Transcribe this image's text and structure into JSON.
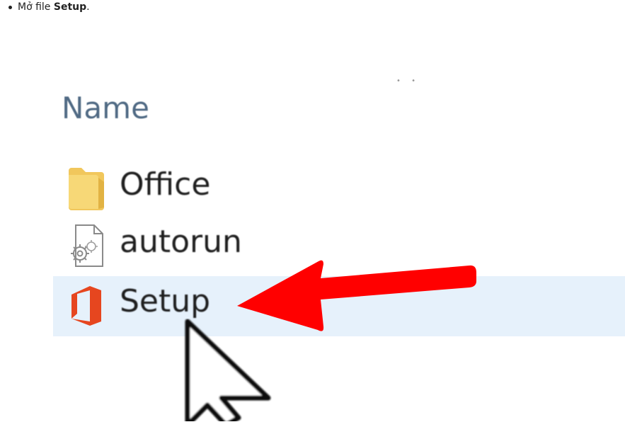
{
  "instruction": {
    "prefix": "Mở file ",
    "target": "Setup",
    "suffix": "."
  },
  "explorer": {
    "column_header": "Name",
    "items": [
      {
        "label": "Office",
        "icon": "folder-icon",
        "selected": false
      },
      {
        "label": "autorun",
        "icon": "settings-file-icon",
        "selected": false
      },
      {
        "label": "Setup",
        "icon": "office-logo-icon",
        "selected": true
      }
    ]
  },
  "colors": {
    "header_text": "#506a84",
    "selection_bg": "#e6f1fb",
    "arrow": "#ff0000",
    "office_logo": "#e6461f",
    "folder": "#f5cf63"
  }
}
